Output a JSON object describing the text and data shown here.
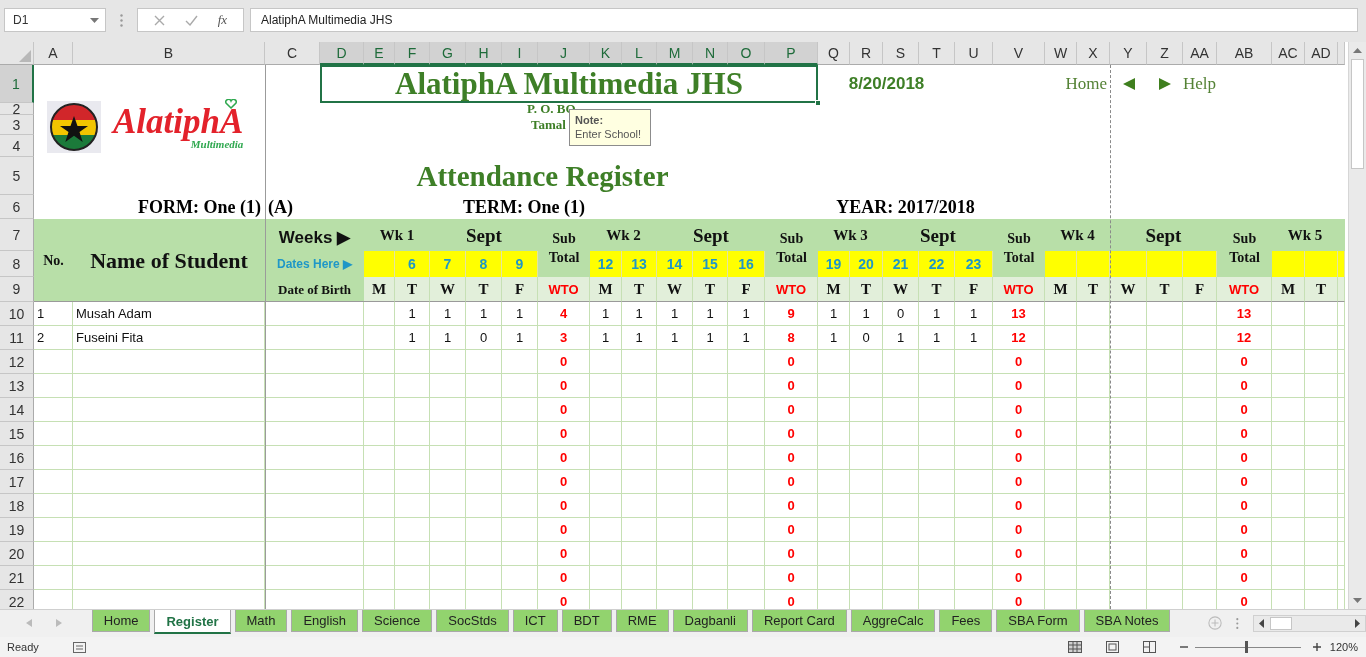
{
  "formula_bar": {
    "name_box": "D1",
    "function_label": "fx",
    "formula": "AlatiphA Multimedia JHS"
  },
  "columns": [
    {
      "label": "A",
      "selected": false
    },
    {
      "label": "B",
      "selected": false
    },
    {
      "label": "C",
      "selected": false
    },
    {
      "label": "D",
      "selected": true
    },
    {
      "label": "E",
      "selected": true
    },
    {
      "label": "F",
      "selected": true
    },
    {
      "label": "G",
      "selected": true
    },
    {
      "label": "H",
      "selected": true
    },
    {
      "label": "I",
      "selected": true
    },
    {
      "label": "J",
      "selected": true
    },
    {
      "label": "K",
      "selected": true
    },
    {
      "label": "L",
      "selected": true
    },
    {
      "label": "M",
      "selected": true
    },
    {
      "label": "N",
      "selected": true
    },
    {
      "label": "O",
      "selected": true
    },
    {
      "label": "P",
      "selected": true
    },
    {
      "label": "Q",
      "selected": false
    },
    {
      "label": "R",
      "selected": false
    },
    {
      "label": "S",
      "selected": false
    },
    {
      "label": "T",
      "selected": false
    },
    {
      "label": "U",
      "selected": false
    },
    {
      "label": "V",
      "selected": false
    },
    {
      "label": "W",
      "selected": false
    },
    {
      "label": "X",
      "selected": false
    },
    {
      "label": "Y",
      "selected": false
    },
    {
      "label": "Z",
      "selected": false
    },
    {
      "label": "AA",
      "selected": false
    },
    {
      "label": "AB",
      "selected": false
    },
    {
      "label": "AC",
      "selected": false
    },
    {
      "label": "AD",
      "selected": false
    }
  ],
  "rows": [
    {
      "label": "1",
      "selected": true
    },
    {
      "label": "2",
      "selected": false
    },
    {
      "label": "3",
      "selected": false
    },
    {
      "label": "4",
      "selected": false
    },
    {
      "label": "5",
      "selected": false
    },
    {
      "label": "6",
      "selected": false
    },
    {
      "label": "7",
      "selected": false
    },
    {
      "label": "8",
      "selected": false
    },
    {
      "label": "9",
      "selected": false
    },
    {
      "label": "10",
      "selected": false
    },
    {
      "label": "11",
      "selected": false
    },
    {
      "label": "12",
      "selected": false
    },
    {
      "label": "13",
      "selected": false
    },
    {
      "label": "14",
      "selected": false
    },
    {
      "label": "15",
      "selected": false
    },
    {
      "label": "16",
      "selected": false
    },
    {
      "label": "17",
      "selected": false
    },
    {
      "label": "18",
      "selected": false
    },
    {
      "label": "19",
      "selected": false
    },
    {
      "label": "20",
      "selected": false
    },
    {
      "label": "21",
      "selected": false
    },
    {
      "label": "22",
      "selected": false
    }
  ],
  "logo": {
    "name": "AlatiphA",
    "tagline": "Multimedia"
  },
  "heading": {
    "school": "AlatiphA Multimedia JHS",
    "address": "P. O. BO",
    "town": "Tamal",
    "date": "8/20/2018",
    "home_link": "Home",
    "help_link": "Help",
    "title": "Attendance Register",
    "form": "FORM: One (1)",
    "stream": "(A)",
    "term": "TERM: One (1)",
    "year": "YEAR: 2017/2018"
  },
  "note": {
    "title": "Note:",
    "text": "Enter School!"
  },
  "register": {
    "no_heading": "No.",
    "name_heading": "Name of Student",
    "weeks_label": "Weeks ▶",
    "dates_label": "Dates Here ▶",
    "dob_heading": "Date of Birth",
    "weeks": [
      {
        "label": "Wk 1",
        "month": "Sept",
        "dates": [
          "6",
          "7",
          "8",
          "9"
        ],
        "days": [
          "M",
          "T",
          "W",
          "T",
          "F"
        ],
        "subtotal": "Sub Total",
        "total_code": "WTO"
      },
      {
        "label": "Wk 2",
        "month": "Sept",
        "dates": [
          "12",
          "13",
          "14",
          "15",
          "16"
        ],
        "days": [
          "M",
          "T",
          "W",
          "T",
          "F"
        ],
        "subtotal": "Sub Total",
        "total_code": "WTO"
      },
      {
        "label": "Wk 3",
        "month": "Sept",
        "dates": [
          "19",
          "20",
          "21",
          "22",
          "23"
        ],
        "days": [
          "M",
          "T",
          "W",
          "T",
          "F"
        ],
        "subtotal": "Sub Total",
        "total_code": "WTO"
      },
      {
        "label": "Wk 4",
        "month": "Sept",
        "days": [
          "M",
          "T",
          "W",
          "T",
          "F"
        ],
        "subtotal": "Sub Total",
        "total_code": "WTO"
      },
      {
        "label": "Wk 5",
        "days": [
          "M",
          "T"
        ]
      }
    ],
    "students": [
      {
        "no": "1",
        "name": "Musah Adam",
        "marks": [
          [
            "1",
            "1",
            "1",
            "1"
          ],
          [
            "1",
            "1",
            "1",
            "1",
            "1"
          ],
          [
            "1",
            "1",
            "0",
            "1",
            "1"
          ]
        ],
        "totals": [
          "4",
          "9",
          "13",
          "13"
        ]
      },
      {
        "no": "2",
        "name": "Fuseini Fita",
        "marks": [
          [
            "1",
            "1",
            "0",
            "1"
          ],
          [
            "1",
            "1",
            "1",
            "1",
            "1"
          ],
          [
            "1",
            "0",
            "1",
            "1",
            "1"
          ]
        ],
        "totals": [
          "3",
          "8",
          "12",
          "12"
        ]
      },
      {
        "totals": [
          "0",
          "0",
          "0",
          "0"
        ]
      },
      {
        "totals": [
          "0",
          "0",
          "0",
          "0"
        ]
      },
      {
        "totals": [
          "0",
          "0",
          "0",
          "0"
        ]
      },
      {
        "totals": [
          "0",
          "0",
          "0",
          "0"
        ]
      },
      {
        "totals": [
          "0",
          "0",
          "0",
          "0"
        ]
      },
      {
        "totals": [
          "0",
          "0",
          "0",
          "0"
        ]
      },
      {
        "totals": [
          "0",
          "0",
          "0",
          "0"
        ]
      },
      {
        "totals": [
          "0",
          "0",
          "0",
          "0"
        ]
      },
      {
        "totals": [
          "0",
          "0",
          "0",
          "0"
        ]
      },
      {
        "totals": [
          "0",
          "0",
          "0",
          "0"
        ]
      },
      {
        "totals": [
          "0",
          "0",
          "0",
          "0"
        ]
      }
    ]
  },
  "sheet_tabs": [
    {
      "label": "Home",
      "selected": false
    },
    {
      "label": "Register",
      "selected": true
    },
    {
      "label": "Math",
      "selected": false
    },
    {
      "label": "English",
      "selected": false
    },
    {
      "label": "Science",
      "selected": false
    },
    {
      "label": "SocStds",
      "selected": false
    },
    {
      "label": "ICT",
      "selected": false
    },
    {
      "label": "BDT",
      "selected": false
    },
    {
      "label": "RME",
      "selected": false
    },
    {
      "label": "Dagbanli",
      "selected": false
    },
    {
      "label": "Report Card",
      "selected": false
    },
    {
      "label": "AggreCalc",
      "selected": false
    },
    {
      "label": "Fees",
      "selected": false
    },
    {
      "label": "SBA Form",
      "selected": false
    },
    {
      "label": "SBA Notes",
      "selected": false
    }
  ],
  "status_bar": {
    "status": "Ready",
    "zoom": {
      "level": 0.48,
      "label": "120%"
    }
  }
}
